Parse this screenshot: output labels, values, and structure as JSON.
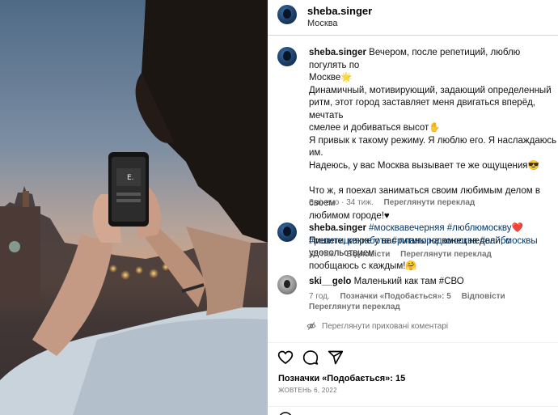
{
  "post": {
    "username": "sheba.singer",
    "location": "Москва"
  },
  "caption": {
    "username": "sheba.singer",
    "lines": [
      "Вечером, после репетиций, люблю погулять по",
      "Москве🌟",
      "Динамичный, мотивирующий, задающий определенный",
      "ритм, этот город заставляет меня двигаться вперёд, мечтать",
      "смелее и добиваться высот✋",
      "Я привык к такому режиму. Я люблю его. Я наслаждаюсь им.",
      "Надеюсь, у вас Москва вызывает те же ощущения😎",
      "",
      "Что ж, я поехал заниматься своим любимым делом в своем",
      "любимом городе!♥",
      "",
      "Пишите, какие у вас планы на конец недели, с удовольствием",
      "пообщаюсь с каждым!🤗"
    ],
    "meta_edited": "Змінено · 34 тиж.",
    "meta_translate": "Переглянути переклад"
  },
  "hashtag_comment": {
    "username": "sheba.singer",
    "line1": "#москвавечерняя #люблюмоскву❤️",
    "line2": "#репетицияработа #ритмгородамосква #вайбмосквы",
    "time": "35 тиж.",
    "reply": "Відповісти",
    "translate": "Переглянути переклад"
  },
  "user_comment": {
    "username": "ski__gelo",
    "text": "Маленький как там #СВО",
    "time": "7 год.",
    "likes": "Позначки «Подобається»: 5",
    "reply": "Відповісти",
    "translate": "Переглянути переклад"
  },
  "hidden_comments": "Переглянути приховані коментарі",
  "footer": {
    "likes": "Позначки «Подобається»: 15",
    "date": "ЖОВТЕНЬ 6, 2022"
  },
  "phone_screen": {
    "label": "E."
  },
  "icons": [
    "heart-icon",
    "comment-icon",
    "share-icon",
    "eye-off-icon"
  ]
}
